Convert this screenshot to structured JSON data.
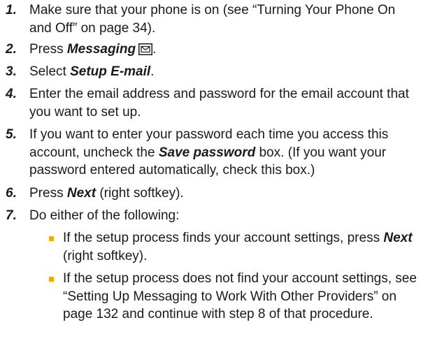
{
  "steps": [
    {
      "num": "1.",
      "text": "Make sure that your phone is on (see “Turning Your Phone On and Off” on page 34)."
    },
    {
      "num": "2.",
      "pre": "Press ",
      "em": "Messaging",
      "post": "."
    },
    {
      "num": "3.",
      "pre": "Select ",
      "em": "Setup E-mail",
      "post": "."
    },
    {
      "num": "4.",
      "text": "Enter the email address and password for the email account that you want to set up."
    },
    {
      "num": "5.",
      "pre": "If you want to enter your password each time you access this account, uncheck the ",
      "em": "Save password",
      "post": " box. (If you want your password entered automatically, check this box.)"
    },
    {
      "num": "6.",
      "pre": "Press ",
      "em": "Next",
      "post": " (right softkey)."
    },
    {
      "num": "7.",
      "text": "Do either of the following:"
    }
  ],
  "bullets": [
    {
      "pre": "If the setup process finds your account settings, press ",
      "em": "Next",
      "post": " (right softkey)."
    },
    {
      "text": "If the setup process does not find your account settings, see “Setting Up Messaging to Work With Other Providers” on page 132 and continue with step 8 of that procedure."
    }
  ],
  "icons": {
    "messaging_key": "envelope-icon"
  },
  "colors": {
    "text": "#1a1a1a",
    "bullet": "#f2a900"
  }
}
